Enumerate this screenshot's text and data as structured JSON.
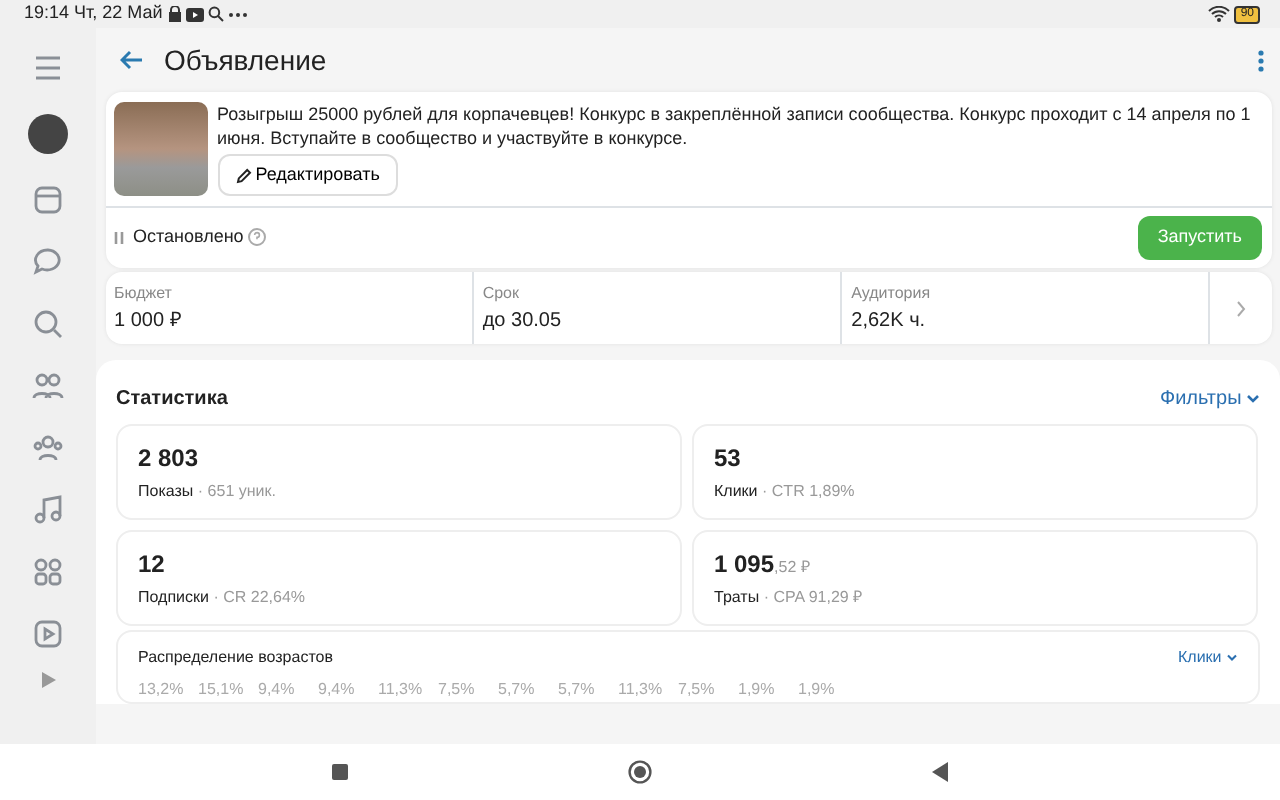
{
  "status_bar": {
    "time": "19:14 Чт, 22 Май",
    "battery": "90"
  },
  "header": {
    "title": "Объявление"
  },
  "ad": {
    "text": "Розыгрыш 25000 рублей для корпачевцев! Конкурс в закреплённой записи сообщества. Конкурс проходит с 14 апреля по 1 июня. Вступайте в сообщество и участвуйте в конкурсе.",
    "edit_button": "Редактировать",
    "status": "Остановлено",
    "launch_button": "Запустить"
  },
  "summary": [
    {
      "label": "Бюджет",
      "value": "1 000 ₽"
    },
    {
      "label": "Срок",
      "value": "до 30.05"
    },
    {
      "label": "Аудитория",
      "value": "2,62K ч."
    }
  ],
  "statistics": {
    "title": "Статистика",
    "filter": "Фильтры",
    "cards": [
      {
        "value": "2 803",
        "label": "Показы",
        "detail": "· 651 уник."
      },
      {
        "value": "53",
        "label": "Клики",
        "detail": "· CTR 1,89%"
      },
      {
        "value": "12",
        "label": "Подписки",
        "detail": "· CR 22,64%"
      },
      {
        "value": "1 095",
        "fraction": ",52 ₽",
        "label": "Траты",
        "detail": "· CPA 91,29 ₽"
      }
    ]
  },
  "age_distribution": {
    "title": "Распределение возрастов",
    "metric": "Клики",
    "percentages": [
      "13,2%",
      "15,1%",
      "9,4%",
      "9,4%",
      "11,3%",
      "7,5%",
      "5,7%",
      "5,7%",
      "11,3%",
      "7,5%",
      "1,9%",
      "1,9%"
    ]
  }
}
